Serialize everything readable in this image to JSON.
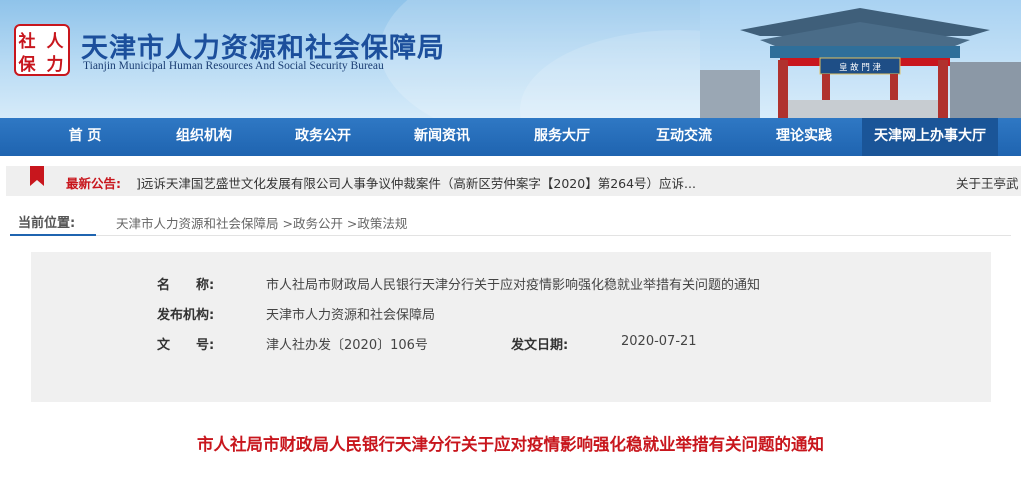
{
  "header": {
    "title": "天津市人力资源和社会保障局",
    "subtitle": "Tianjin Municipal Human Resources And Social Security Bureau",
    "logo_chars": [
      "社",
      "人",
      "保",
      "力"
    ],
    "gate_sign": "皇 故 門 津"
  },
  "nav": {
    "items": [
      "首 页",
      "组织机构",
      "政务公开",
      "新闻资讯",
      "服务大厅",
      "互动交流",
      "理论实践",
      "天津网上办事大厅"
    ]
  },
  "notice": {
    "label": "最新公告:",
    "text": "]远诉天津国艺盛世文化发展有限公司人事争议仲裁案件（高新区劳仲案字【2020】第264号）应诉...",
    "text2": "关于王亭武"
  },
  "breadcrumb": {
    "label": "当前位置:",
    "path": "天津市人力资源和社会保障局 >政务公开 >政策法规"
  },
  "info": {
    "name_label": "名　　称:",
    "name_value": "市人社局市财政局人民银行天津分行关于应对疫情影响强化稳就业举措有关问题的通知",
    "org_label": "发布机构:",
    "org_value": "天津市人力资源和社会保障局",
    "docno_label": "文　　号:",
    "docno_value": "津人社办发〔2020〕106号",
    "date_label": "发文日期:",
    "date_value": "2020-07-21"
  },
  "article": {
    "title": "市人社局市财政局人民银行天津分行关于应对疫情影响强化稳就业举措有关问题的通知"
  },
  "colors": {
    "nav_blue": "#1f64b0",
    "title_blue": "#1c4f9c",
    "accent_red": "#c8161d",
    "info_bg": "#f0f0f0"
  }
}
